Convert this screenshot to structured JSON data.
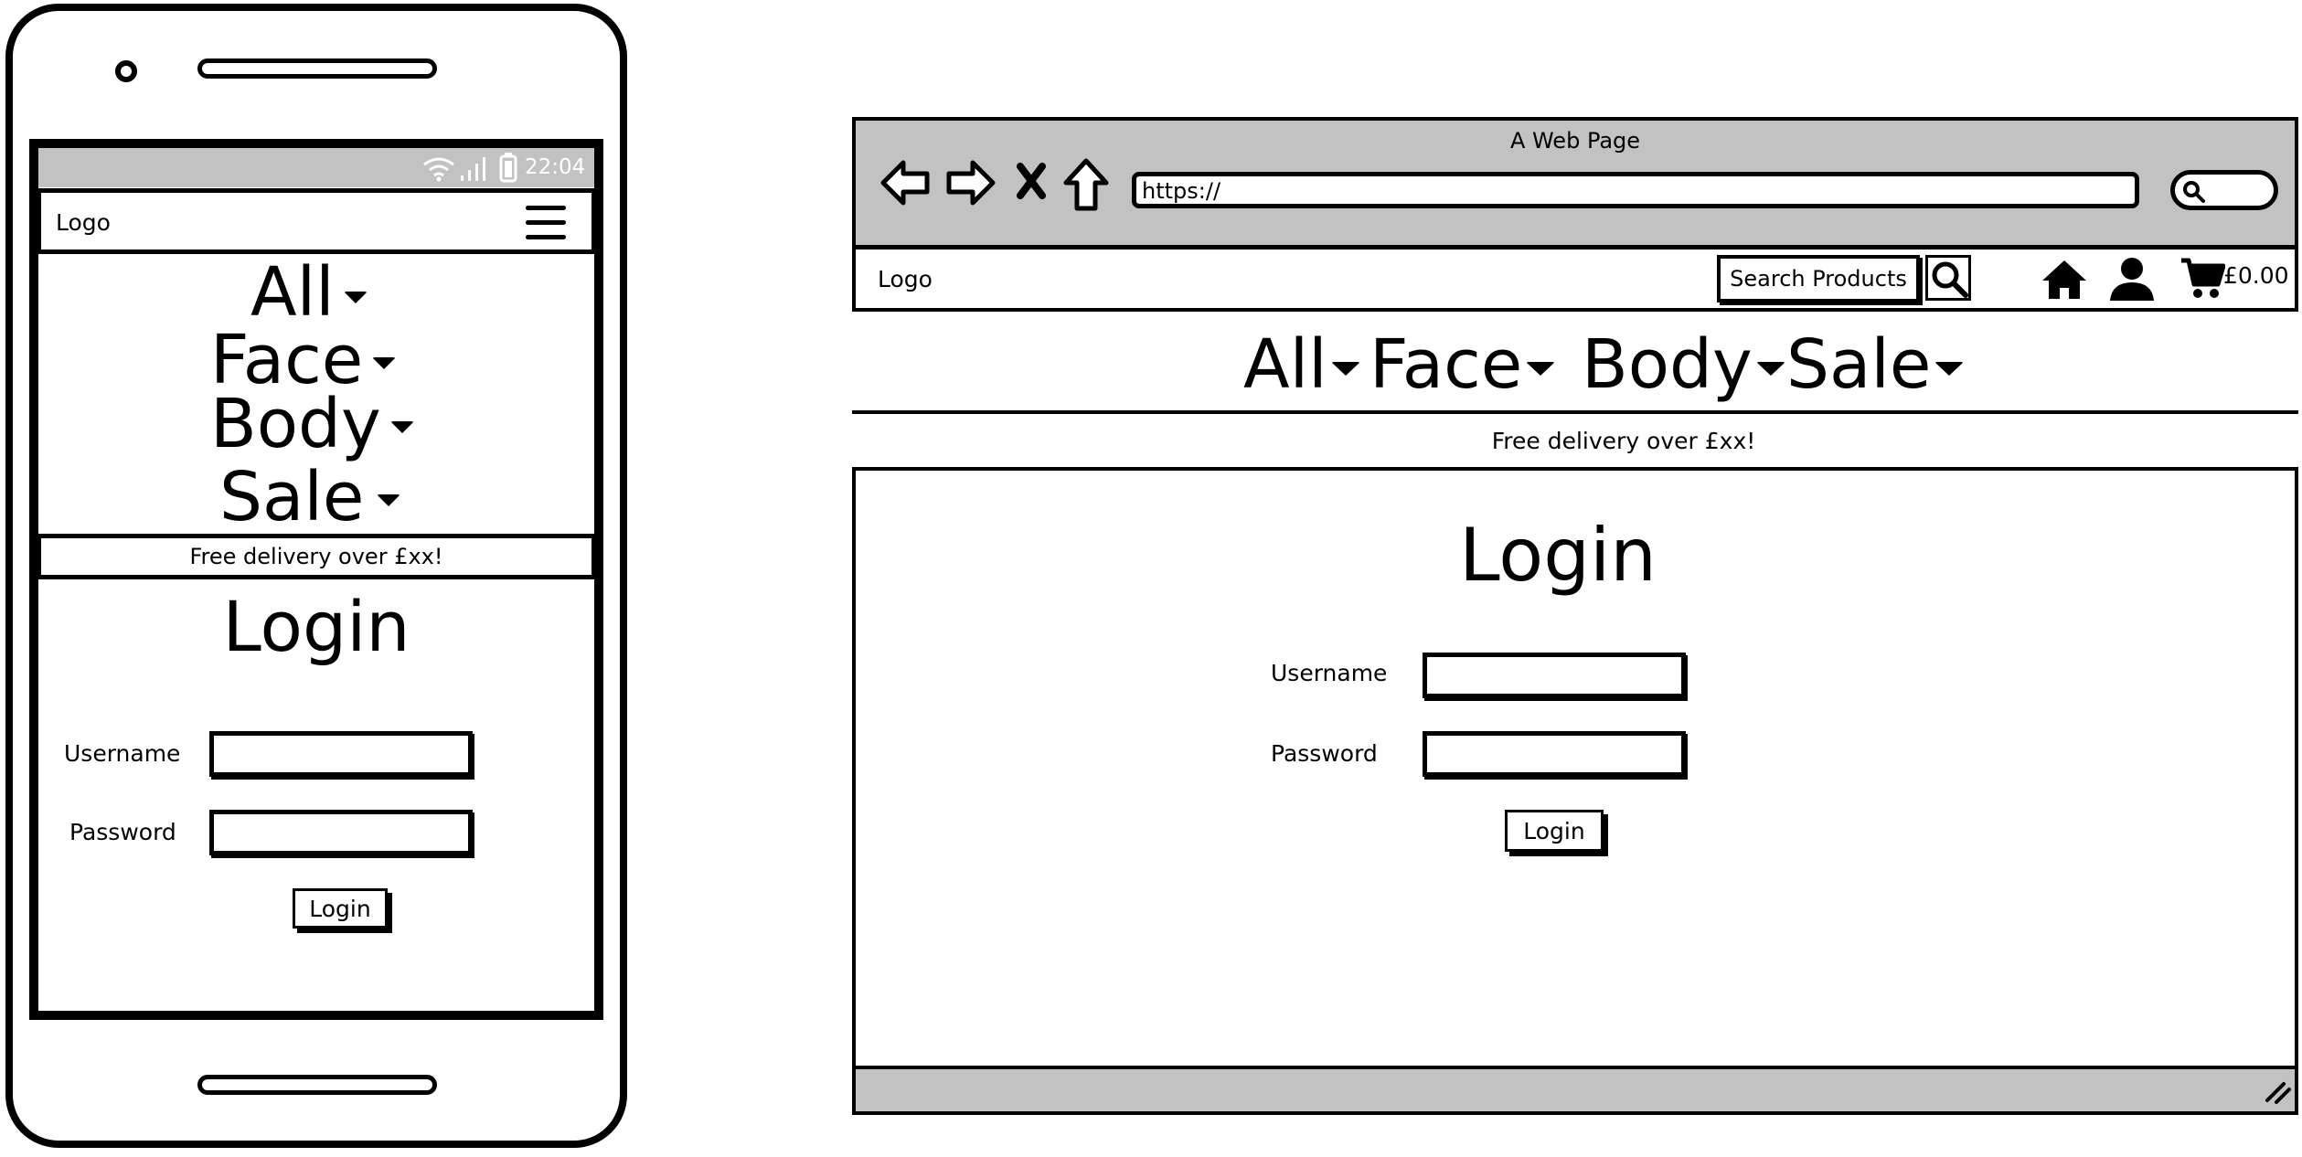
{
  "mobile": {
    "status_bar": {
      "time": "22:04"
    },
    "header": {
      "logo": "Logo"
    },
    "nav": [
      {
        "label": "All"
      },
      {
        "label": "Face"
      },
      {
        "label": "Body"
      },
      {
        "label": "Sale"
      }
    ],
    "banner": "Free delivery over £xx!",
    "login": {
      "title": "Login",
      "username_label": "Username",
      "password_label": "Password",
      "button": "Login"
    }
  },
  "desktop": {
    "window_title": "A Web Page",
    "url": "https://",
    "header": {
      "logo": "Logo",
      "search_label": "Search Products",
      "cart_total": "£0.00"
    },
    "nav": [
      {
        "label": "All"
      },
      {
        "label": "Face"
      },
      {
        "label": "Body"
      },
      {
        "label": "Sale"
      }
    ],
    "banner": "Free delivery over £xx!",
    "login": {
      "title": "Login",
      "username_label": "Username",
      "password_label": "Password",
      "button": "Login"
    }
  },
  "colors": {
    "chrome_gray": "#c2c2c2",
    "ink": "#000000",
    "paper": "#ffffff"
  },
  "icons": [
    "camera-icon",
    "speaker-icon",
    "wifi-icon",
    "signal-icon",
    "battery-icon",
    "hamburger-menu-icon",
    "back-arrow-icon",
    "forward-arrow-icon",
    "close-icon",
    "home-outline-icon",
    "search-icon",
    "home-icon",
    "user-icon",
    "cart-icon",
    "resize-grip-icon"
  ]
}
